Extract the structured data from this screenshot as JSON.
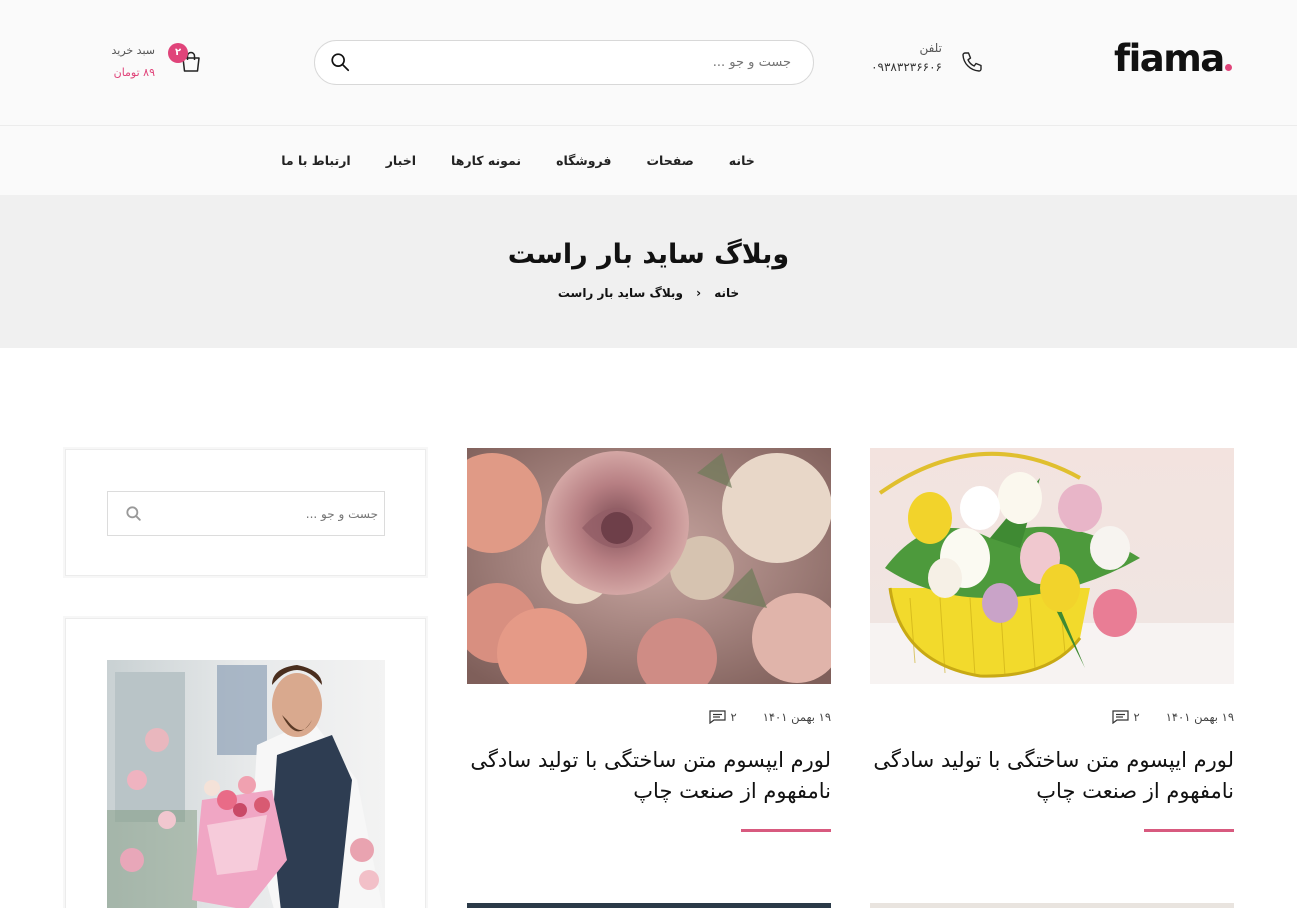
{
  "header": {
    "logo_text": "fiama",
    "phone_label": "تلفن",
    "phone_number": "۰۹۳۸۳۲۳۶۶۰۶",
    "search_placeholder": "جست و جو ...",
    "cart_label": "سبد خرید",
    "cart_total": "۸۹ تومان",
    "cart_count": "۲"
  },
  "nav": {
    "items": [
      {
        "label": "خانه"
      },
      {
        "label": "صفحات"
      },
      {
        "label": "فروشگاه"
      },
      {
        "label": "نمونه کارها"
      },
      {
        "label": "اخبار"
      },
      {
        "label": "ارتباط با ما"
      }
    ]
  },
  "page": {
    "title": "وبلاگ ساید بار راست",
    "breadcrumb": {
      "home": "خانه",
      "current": "وبلاگ ساید بار راست"
    }
  },
  "sidebar": {
    "search_placeholder": "جست و جو ..."
  },
  "posts": [
    {
      "date": "۱۹ بهمن ۱۴۰۱",
      "comments": "۲",
      "title": "لورم ایپسوم متن ساختگی با تولید سادگی نامفهوم از صنعت چاپ",
      "image": "tulip-basket"
    },
    {
      "date": "۱۹ بهمن ۱۴۰۱",
      "comments": "۲",
      "title": "لورم ایپسوم متن ساختگی با تولید سادگی نامفهوم از صنعت چاپ",
      "image": "roses"
    }
  ],
  "colors": {
    "accent": "#e0447a",
    "underline": "#d85a7f",
    "band": "#f0f0f0"
  }
}
